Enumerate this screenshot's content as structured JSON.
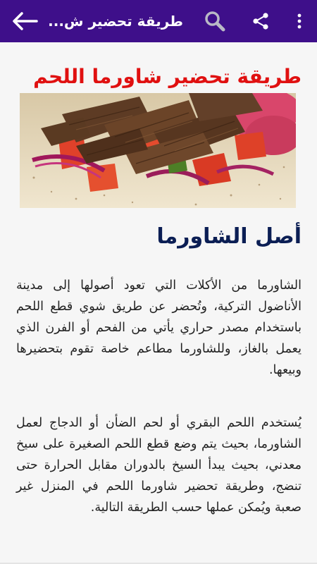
{
  "appbar": {
    "title": "طريقة تحضير ش...",
    "icons": [
      "back-arrow-icon",
      "search-icon",
      "share-icon",
      "more-vert-icon"
    ],
    "color": "#3e0f8a"
  },
  "article": {
    "headline": "طريقة تحضير شاورما اللحم",
    "headline_color": "#e01010",
    "hero_image": "shawarma-meat-wrap-photo",
    "section_title": "أصل الشاورما",
    "paragraphs": [
      "الشاورما من الأكلات التي تعود أصولها إلى مدينة الأناضول التركية، وتُحضر عن طريق شوي قطع اللحم باستخدام مصدر حراري يأتي من الفحم أو الفرن الذي يعمل بالغاز، وللشاورما مطاعم خاصة تقوم بتحضيرها وبيعها.",
      "يُستخدم اللحم البقري أو لحم الضأن أو الدجاج لعمل الشاورما، بحيث يتم وضع قطع اللحم الصغيرة على سيخ معدني، بحيث يبدأ السيخ بالدوران مقابل الحرارة حتى تنضج، وطريقة تحضير شاورما اللحم في المنزل غير صعبة ويُمكن عملها حسب الطريقة التالية."
    ]
  }
}
